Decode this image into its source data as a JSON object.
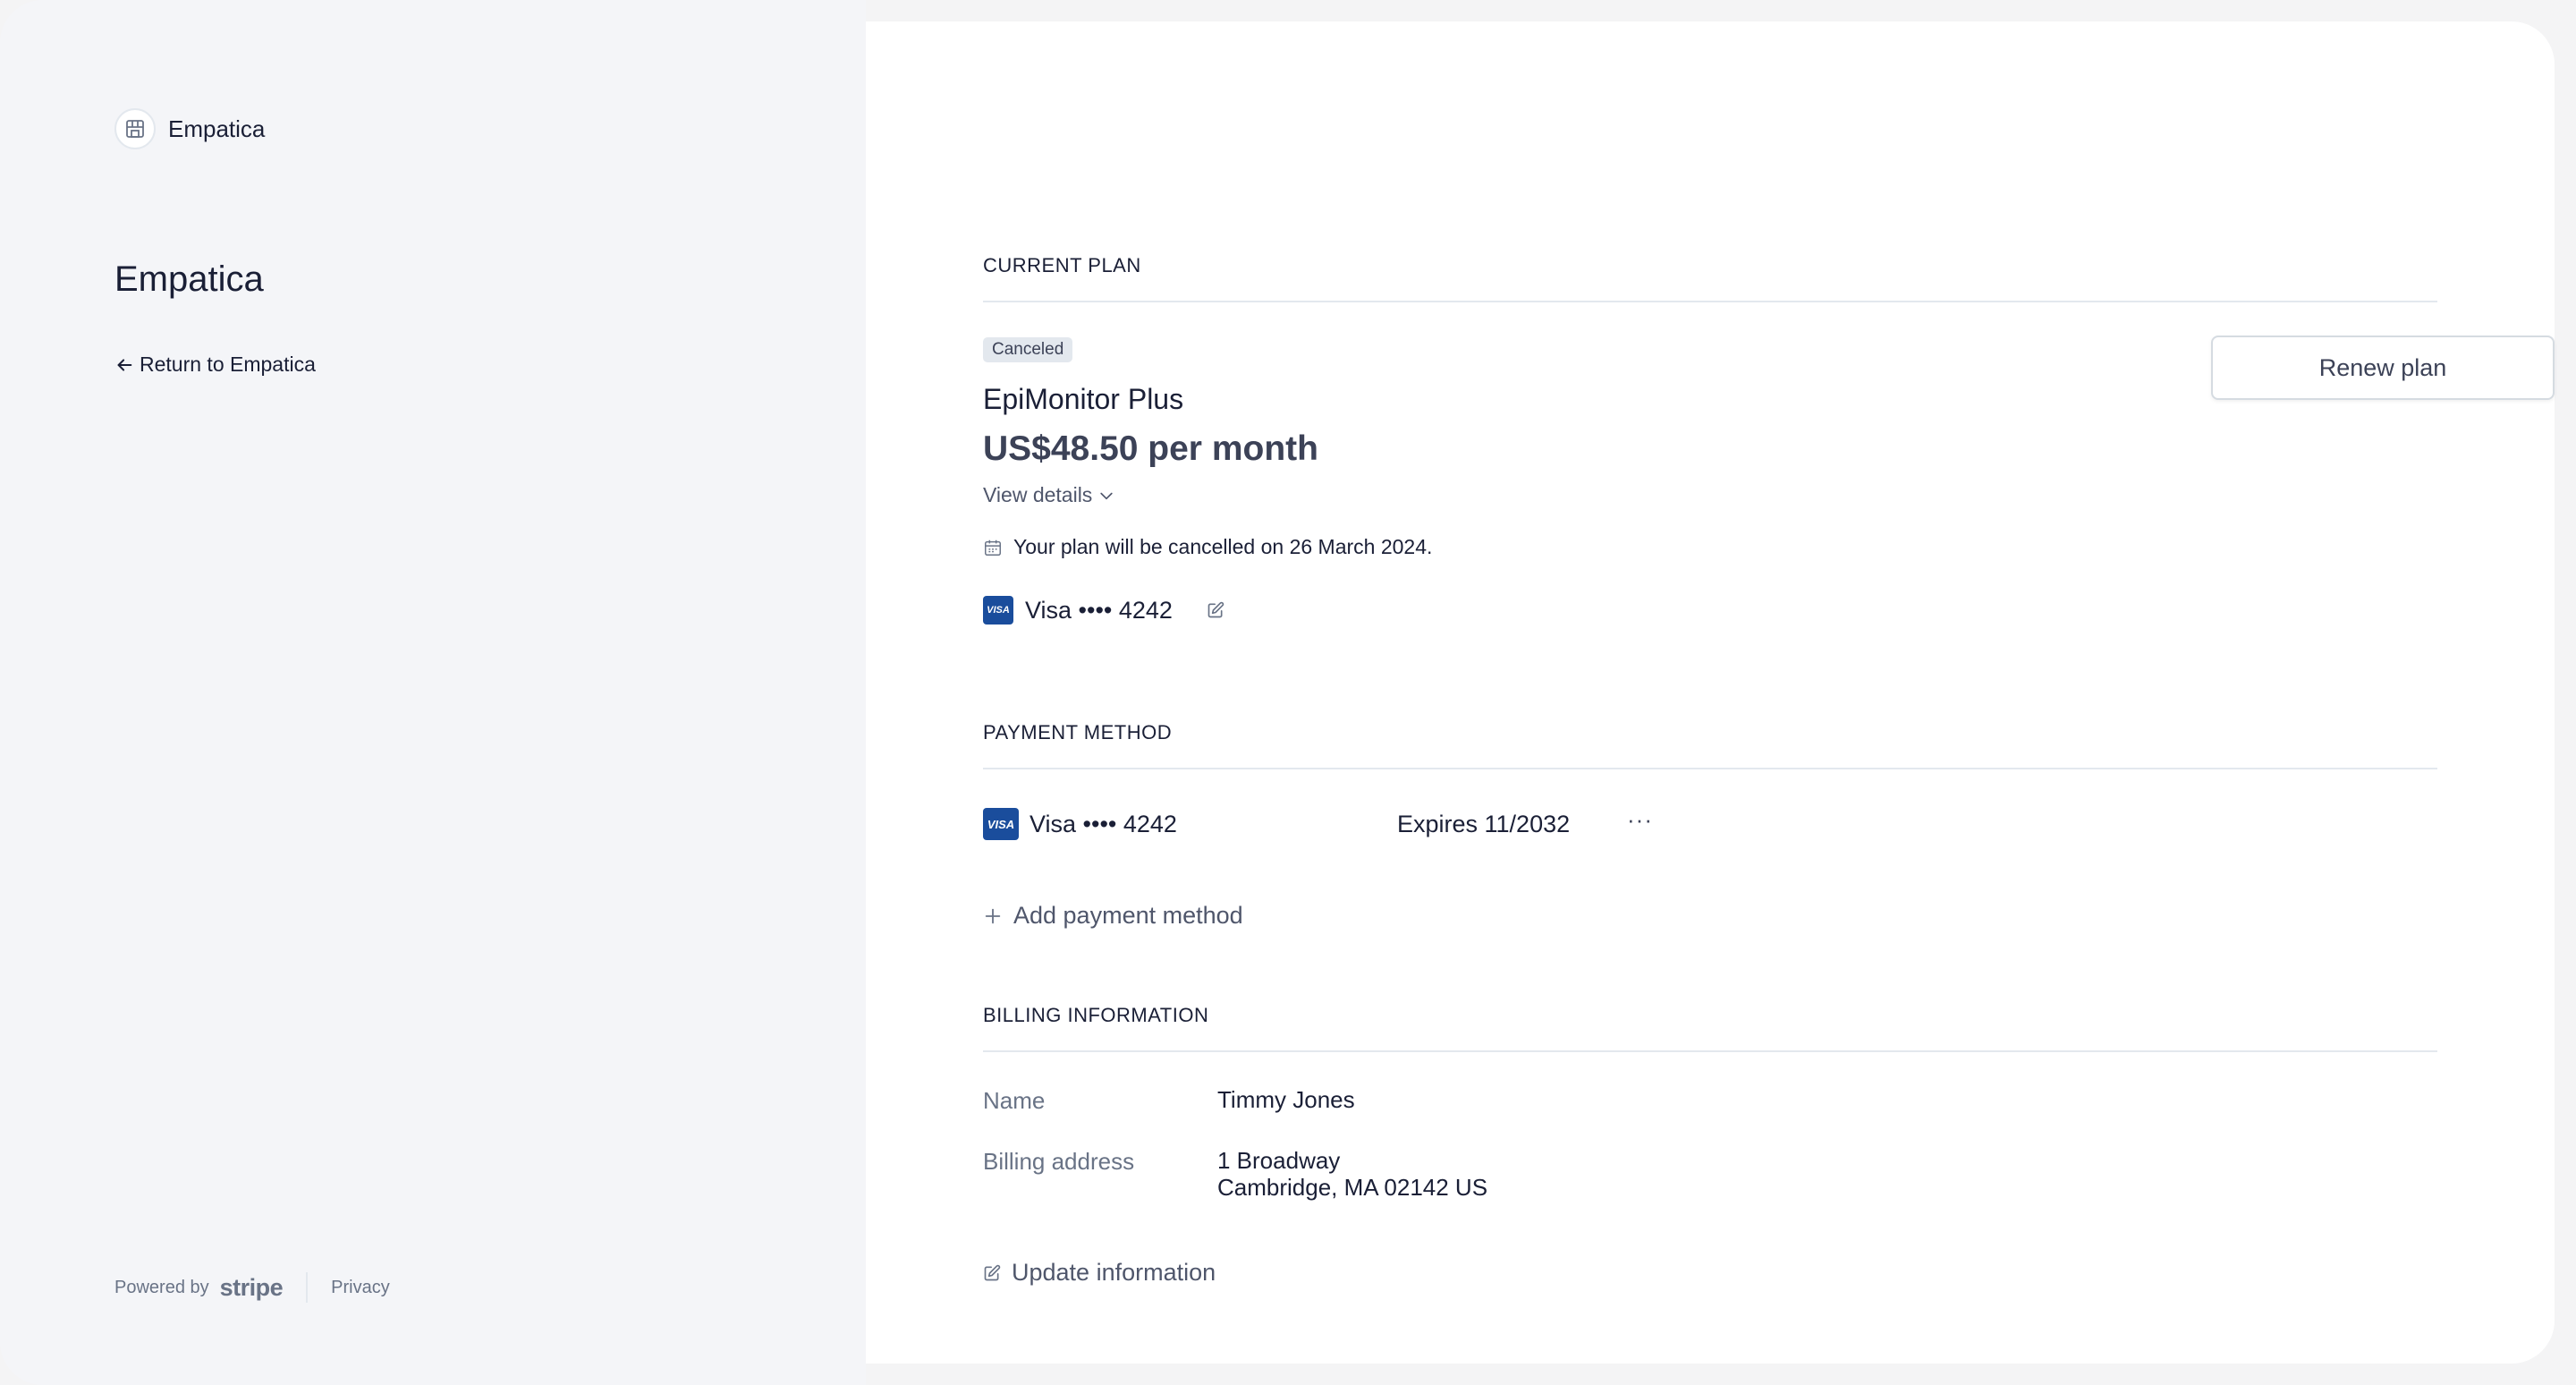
{
  "sidebar": {
    "brand_name": "Empatica",
    "merchant_title": "Empatica",
    "return_link": "Return to Empatica",
    "footer": {
      "powered_by": "Powered by",
      "stripe": "stripe",
      "privacy": "Privacy"
    }
  },
  "current_plan": {
    "section_title": "CURRENT PLAN",
    "status_badge": "Canceled",
    "plan_name": "EpiMonitor Plus",
    "price": "US$48.50 per month",
    "view_details": "View details",
    "cancel_note": "Your plan will be cancelled on 26 March 2024.",
    "card_brand_logo": "VISA",
    "card_text": "Visa •••• 4242",
    "renew_button": "Renew plan"
  },
  "payment_method": {
    "section_title": "PAYMENT METHOD",
    "card_brand_logo": "VISA",
    "card_text": "Visa •••• 4242",
    "expires": "Expires 11/2032",
    "more": "···",
    "add_label": "Add payment method"
  },
  "billing_information": {
    "section_title": "BILLING INFORMATION",
    "name_label": "Name",
    "name_value": "Timmy Jones",
    "address_label": "Billing address",
    "address_line1": "1 Broadway",
    "address_line2": "Cambridge, MA 02142 US",
    "update_label": "Update information"
  },
  "icons": {
    "brand": "storefront-icon",
    "return": "arrow-left-icon",
    "view_details": "chevron-down-icon",
    "calendar": "calendar-icon",
    "edit": "edit-icon",
    "add": "plus-icon"
  },
  "colors": {
    "visa_blue": "#1a4d9c",
    "text_primary": "#1a1f36",
    "text_secondary": "#697386",
    "divider": "#e3e8ee"
  }
}
